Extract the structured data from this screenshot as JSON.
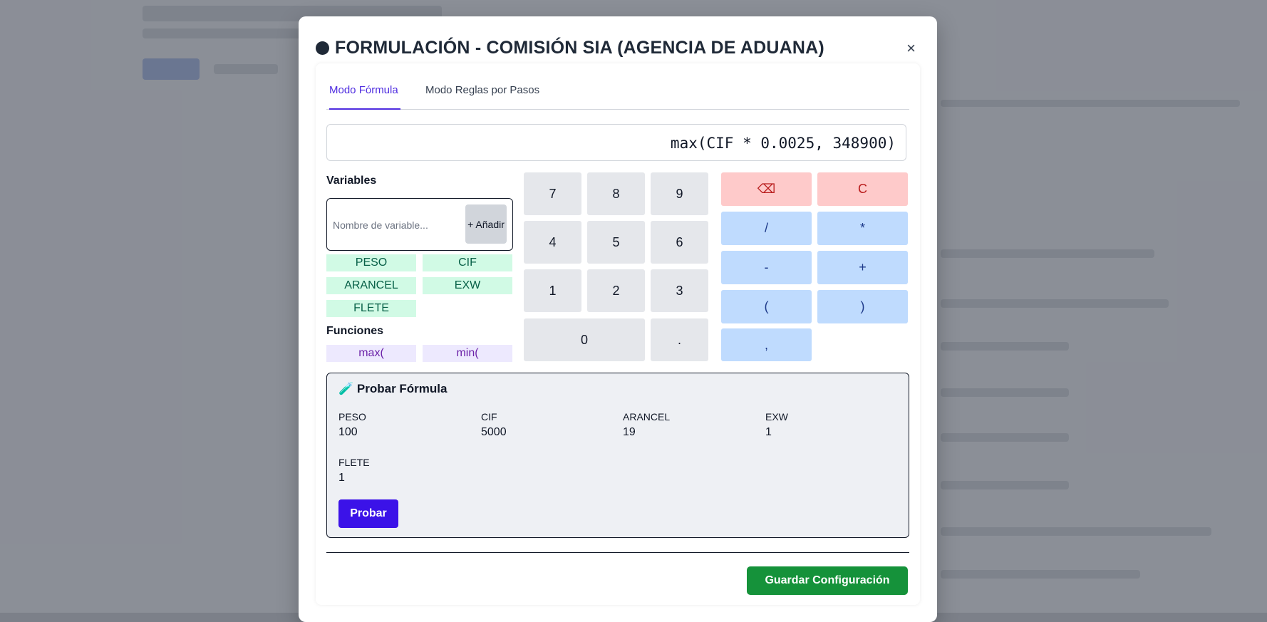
{
  "modal": {
    "title": "FORMULACIÓN - COMISIÓN SIA (AGENCIA DE ADUANA)",
    "close": "×"
  },
  "tabs": [
    {
      "label": "Modo Fórmula",
      "active": true
    },
    {
      "label": "Modo Reglas por Pasos",
      "active": false
    }
  ],
  "formula": "max(CIF * 0.0025, 348900)",
  "variables": {
    "label": "Variables",
    "input_placeholder": "Nombre de variable...",
    "add_label": "+ Añadir",
    "items": [
      "PESO",
      "CIF",
      "ARANCEL",
      "EXW",
      "FLETE"
    ]
  },
  "functions": {
    "label": "Funciones",
    "items": [
      "max(",
      "min("
    ]
  },
  "keypad": {
    "digits": [
      "7",
      "8",
      "9",
      "4",
      "5",
      "6",
      "1",
      "2",
      "3",
      "0",
      "."
    ],
    "backspace": "⌫",
    "clear": "C",
    "operators": [
      "/",
      "*",
      "-",
      "+",
      "(",
      ")",
      ","
    ]
  },
  "test": {
    "title": "🧪 Probar Fórmula",
    "fields": [
      {
        "name": "PESO",
        "value": "100"
      },
      {
        "name": "CIF",
        "value": "5000"
      },
      {
        "name": "ARANCEL",
        "value": "19"
      },
      {
        "name": "EXW",
        "value": "1"
      },
      {
        "name": "FLETE",
        "value": "1"
      }
    ],
    "button": "Probar"
  },
  "save_button": "Guardar Configuración",
  "colors": {
    "accent": "#4f2de0",
    "primary_button": "#3b12e8",
    "save_button": "#15923a",
    "variable_chip": "#d1fae5",
    "function_chip": "#ede9fe",
    "operator_key": "#bfdbfe",
    "danger_key": "#fecaca"
  }
}
